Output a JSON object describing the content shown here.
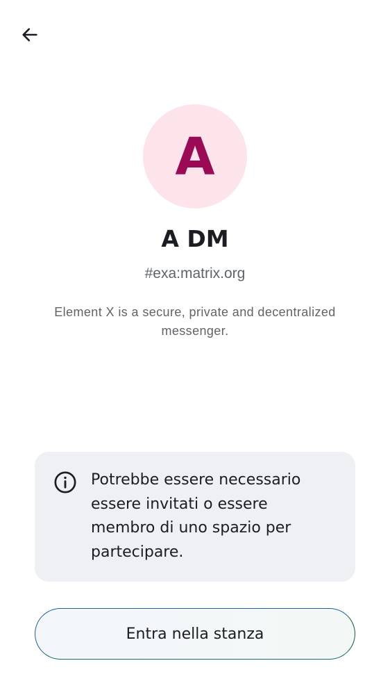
{
  "header": {
    "back_icon": "arrow-left-icon"
  },
  "room": {
    "avatar_initial": "A",
    "avatar_bg": "#fde4ea",
    "avatar_fg": "#9b0b55",
    "name": "A DM",
    "alias": "#exa:matrix.org",
    "topic": "Element X is a secure, private and decentralized messenger."
  },
  "notice": {
    "icon": "info-icon",
    "text": "Potrebbe essere necessario essere invitati o essere membro di uno spazio per partecipare."
  },
  "actions": {
    "join_label": "Entra nella stanza"
  }
}
